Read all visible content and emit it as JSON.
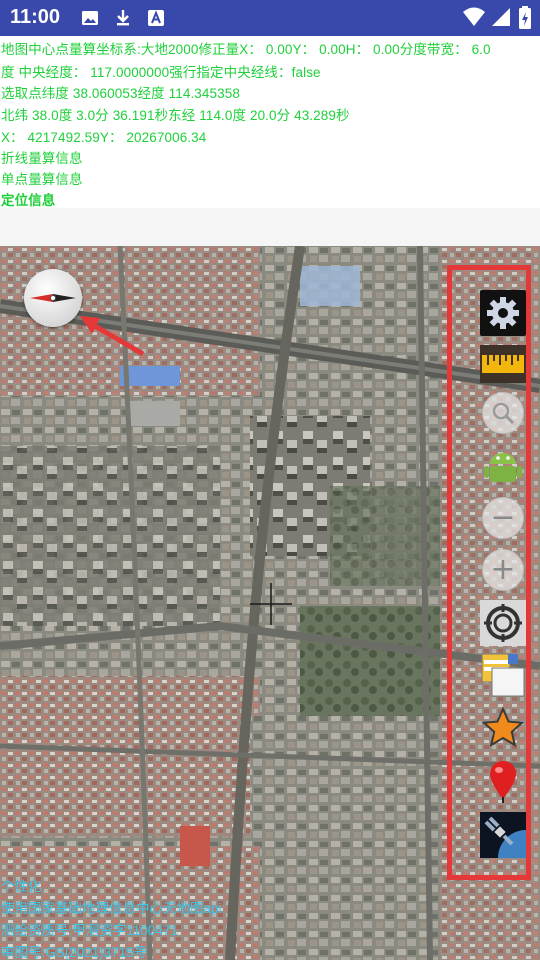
{
  "status_bar": {
    "time": "11:00"
  },
  "info_panel": {
    "line1": "地图中心点量算坐标系:大地2000修正量X： 0.00Y： 0.00H： 0.00分度带宽： 6.0",
    "line2": "度 中央经度： 117.0000000强行指定中央经线：false",
    "line3": "选取点纬度 38.060053经度 114.345358",
    "line4": "北纬 38.0度 3.0分 36.191秒东经 114.0度 20.0分 43.289秒",
    "line5": "X： 4217492.59Y： 20267006.34",
    "line6": "折线量算信息",
    "line7": "单点量算信息",
    "line8": "定位信息"
  },
  "map": {
    "credits": [
      "个性化",
      "使用国家基础地理信息中心天地图api",
      " 测绘资质号:甲测资字1100471",
      " 审图号:GS(2021)3715号"
    ]
  },
  "toolbar": {
    "items": [
      "settings",
      "ruler",
      "search",
      "android",
      "zoom-out",
      "zoom-in",
      "locate",
      "layers",
      "favorites",
      "marker",
      "satellite"
    ],
    "zoom_out_symbol": "−",
    "zoom_in_symbol": "+"
  },
  "colors": {
    "status_bar": "#3949ab",
    "info_text": "#1fd03a",
    "credit_text": "#36c9f0",
    "highlight_frame": "#e53939"
  }
}
